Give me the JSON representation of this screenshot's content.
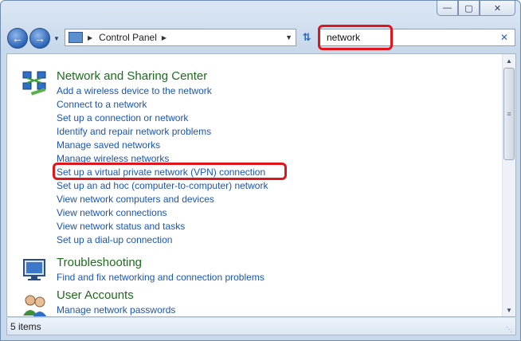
{
  "window": {
    "caption_buttons": [
      "minimize-icon",
      "maximize-icon",
      "close-icon"
    ]
  },
  "toolbar": {
    "breadcrumb": "Control Panel",
    "search_value": "network"
  },
  "sections": [
    {
      "title": "Network and Sharing Center",
      "icon": "network-icon",
      "links": [
        "Add a wireless device to the network",
        "Connect to a network",
        "Set up a connection or network",
        "Identify and repair network problems",
        "Manage saved networks",
        "Manage wireless networks",
        "Set up a virtual private network (VPN) connection",
        "Set up an ad hoc (computer-to-computer) network",
        "View network computers and devices",
        "View network connections",
        "View network status and tasks",
        "Set up a dial-up connection"
      ]
    },
    {
      "title": "Troubleshooting",
      "icon": "troubleshooting-icon",
      "links": [
        "Find and fix networking and connection problems"
      ]
    },
    {
      "title": "User Accounts",
      "icon": "user-accounts-icon",
      "links": [
        "Manage network passwords"
      ]
    }
  ],
  "status": {
    "item_count": "5 items"
  },
  "colors": {
    "highlight": "#e0151b",
    "link": "#1a55b4",
    "heading": "#1e6b1e"
  }
}
